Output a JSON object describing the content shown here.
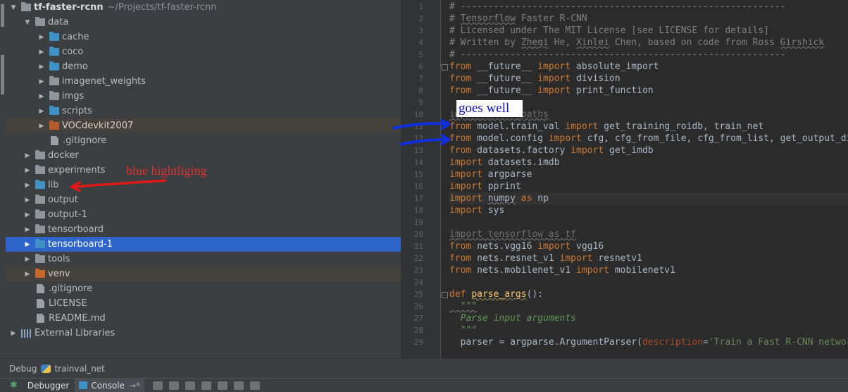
{
  "project": {
    "name": "tf-faster-rcnn",
    "path": "~/Projects/tf-faster-rcnn",
    "tree": [
      {
        "label": "data",
        "depth": 1,
        "type": "folder-gray",
        "arrow": "open"
      },
      {
        "label": "cache",
        "depth": 2,
        "type": "folder-blue",
        "arrow": "closed"
      },
      {
        "label": "coco",
        "depth": 2,
        "type": "folder-blue",
        "arrow": "closed"
      },
      {
        "label": "demo",
        "depth": 2,
        "type": "folder-blue",
        "arrow": "closed"
      },
      {
        "label": "imagenet_weights",
        "depth": 2,
        "type": "folder-gray",
        "arrow": "closed"
      },
      {
        "label": "imgs",
        "depth": 2,
        "type": "folder-gray",
        "arrow": "closed"
      },
      {
        "label": "scripts",
        "depth": 2,
        "type": "folder-blue",
        "arrow": "closed"
      },
      {
        "label": "VOCdevkit2007",
        "depth": 2,
        "type": "folder-red",
        "arrow": "closed",
        "excluded": true
      },
      {
        "label": ".gitignore",
        "depth": 2,
        "type": "file",
        "arrow": "none"
      },
      {
        "label": "docker",
        "depth": 1,
        "type": "folder-gray",
        "arrow": "closed"
      },
      {
        "label": "experiments",
        "depth": 1,
        "type": "folder-gray",
        "arrow": "closed"
      },
      {
        "label": "lib",
        "depth": 1,
        "type": "folder-blue",
        "arrow": "closed"
      },
      {
        "label": "output",
        "depth": 1,
        "type": "folder-gray",
        "arrow": "closed"
      },
      {
        "label": "output-1",
        "depth": 1,
        "type": "folder-gray",
        "arrow": "closed"
      },
      {
        "label": "tensorboard",
        "depth": 1,
        "type": "folder-gray",
        "arrow": "closed"
      },
      {
        "label": "tensorboard-1",
        "depth": 1,
        "type": "folder-blue",
        "arrow": "closed",
        "selected": true
      },
      {
        "label": "tools",
        "depth": 1,
        "type": "folder-gray",
        "arrow": "closed"
      },
      {
        "label": "venv",
        "depth": 1,
        "type": "folder-orange",
        "arrow": "closed",
        "excluded": true
      },
      {
        "label": ".gitignore",
        "depth": 1,
        "type": "file",
        "arrow": "none"
      },
      {
        "label": "LICENSE",
        "depth": 1,
        "type": "file",
        "arrow": "none"
      },
      {
        "label": "README.md",
        "depth": 1,
        "type": "file",
        "arrow": "none"
      },
      {
        "label": "External Libraries",
        "depth": 0,
        "type": "libs",
        "arrow": "closed"
      }
    ]
  },
  "editor": {
    "current_line": 17,
    "lines": [
      {
        "n": 1,
        "segs": [
          [
            "c",
            "# -----------------------------------------------------------"
          ]
        ]
      },
      {
        "n": 2,
        "segs": [
          [
            "c",
            "# "
          ],
          [
            "cw",
            "Tensorflow"
          ],
          [
            "c",
            " Faster R-CNN"
          ]
        ]
      },
      {
        "n": 3,
        "segs": [
          [
            "c",
            "# Licensed under The MIT License [see LICENSE for details]"
          ]
        ]
      },
      {
        "n": 4,
        "segs": [
          [
            "c",
            "# Written by "
          ],
          [
            "cw",
            "Zheqi"
          ],
          [
            "c",
            " He, "
          ],
          [
            "cw",
            "Xinlei"
          ],
          [
            "c",
            " Chen, based on code from Ross "
          ],
          [
            "cw",
            "Girshick"
          ]
        ]
      },
      {
        "n": 5,
        "segs": [
          [
            "c",
            "# -----------------------------------------------------------"
          ]
        ]
      },
      {
        "n": 6,
        "segs": [
          [
            "k",
            "from "
          ],
          [
            "t",
            "__future__ "
          ],
          [
            "k",
            "import "
          ],
          [
            "t",
            "absolute_import"
          ]
        ]
      },
      {
        "n": 7,
        "segs": [
          [
            "k",
            "from "
          ],
          [
            "t",
            "__future__ "
          ],
          [
            "k",
            "import "
          ],
          [
            "t",
            "division"
          ]
        ]
      },
      {
        "n": 8,
        "segs": [
          [
            "k",
            "from "
          ],
          [
            "t",
            "__future__ "
          ],
          [
            "k",
            "import "
          ],
          [
            "t",
            "print_function"
          ]
        ]
      },
      {
        "n": 9,
        "segs": []
      },
      {
        "n": 10,
        "segs": [
          [
            "dw",
            "import _init_paths"
          ]
        ]
      },
      {
        "n": 11,
        "segs": [
          [
            "k",
            "from "
          ],
          [
            "t",
            "model.train_val "
          ],
          [
            "k",
            "import "
          ],
          [
            "t",
            "get_training_roidb, train_net"
          ]
        ]
      },
      {
        "n": 12,
        "segs": [
          [
            "k",
            "from "
          ],
          [
            "t",
            "model.config "
          ],
          [
            "k",
            "import "
          ],
          [
            "t",
            "cfg, cfg_from_file, cfg_from_list, get_output_dir"
          ]
        ]
      },
      {
        "n": 13,
        "segs": [
          [
            "k",
            "from "
          ],
          [
            "t",
            "datasets.factory "
          ],
          [
            "k",
            "import "
          ],
          [
            "t",
            "get_imdb"
          ]
        ]
      },
      {
        "n": 14,
        "segs": [
          [
            "k",
            "import "
          ],
          [
            "t",
            "datasets.imdb"
          ]
        ]
      },
      {
        "n": 15,
        "segs": [
          [
            "k",
            "import "
          ],
          [
            "t",
            "argparse"
          ]
        ]
      },
      {
        "n": 16,
        "segs": [
          [
            "k",
            "import "
          ],
          [
            "t",
            "pprint"
          ]
        ]
      },
      {
        "n": 17,
        "segs": [
          [
            "k",
            "import "
          ],
          [
            "tw",
            "numpy"
          ],
          [
            "k",
            " as "
          ],
          [
            "t",
            "np"
          ]
        ]
      },
      {
        "n": 18,
        "segs": [
          [
            "k",
            "import "
          ],
          [
            "t",
            "sys"
          ]
        ]
      },
      {
        "n": 19,
        "segs": []
      },
      {
        "n": 20,
        "segs": [
          [
            "dw",
            "import tensorflow as tf"
          ]
        ]
      },
      {
        "n": 21,
        "segs": [
          [
            "k",
            "from "
          ],
          [
            "t",
            "nets.vgg16 "
          ],
          [
            "k",
            "import "
          ],
          [
            "t",
            "vgg16"
          ]
        ]
      },
      {
        "n": 22,
        "segs": [
          [
            "k",
            "from "
          ],
          [
            "t",
            "nets.resnet_v1 "
          ],
          [
            "k",
            "import "
          ],
          [
            "t",
            "resnetv1"
          ]
        ]
      },
      {
        "n": 23,
        "segs": [
          [
            "k",
            "from "
          ],
          [
            "t",
            "nets.mobilenet_v1 "
          ],
          [
            "k",
            "import "
          ],
          [
            "t",
            "mobilenetv1"
          ]
        ]
      },
      {
        "n": 24,
        "segs": []
      },
      {
        "n": 25,
        "segs": [
          [
            "k",
            "def "
          ],
          [
            "fw",
            "parse_args"
          ],
          [
            "t",
            "():"
          ]
        ]
      },
      {
        "n": 26,
        "segs": [
          [
            "dq",
            "  \"\"\""
          ]
        ]
      },
      {
        "n": 27,
        "segs": [
          [
            "d",
            "  Parse input arguments"
          ]
        ]
      },
      {
        "n": 28,
        "segs": [
          [
            "d",
            "  \"\"\""
          ]
        ]
      },
      {
        "n": 29,
        "segs": [
          [
            "t",
            "  parser = argparse.ArgumentParser("
          ],
          [
            "p",
            "description"
          ],
          [
            "t",
            "="
          ],
          [
            "s",
            "'Train a Fast R-CNN network'"
          ]
        ]
      }
    ]
  },
  "debug": {
    "label": "Debug",
    "config": "trainval_net",
    "tab_debugger": "Debugger",
    "tab_console": "Console",
    "console_suffix": "→*"
  },
  "annotations": {
    "goes_well": "goes  well",
    "blue_highlight": "blue  hightliging"
  },
  "colors": {
    "selection": "#2f65ca",
    "arrow_blue": "#1030e0",
    "arrow_red": "#e01818"
  }
}
